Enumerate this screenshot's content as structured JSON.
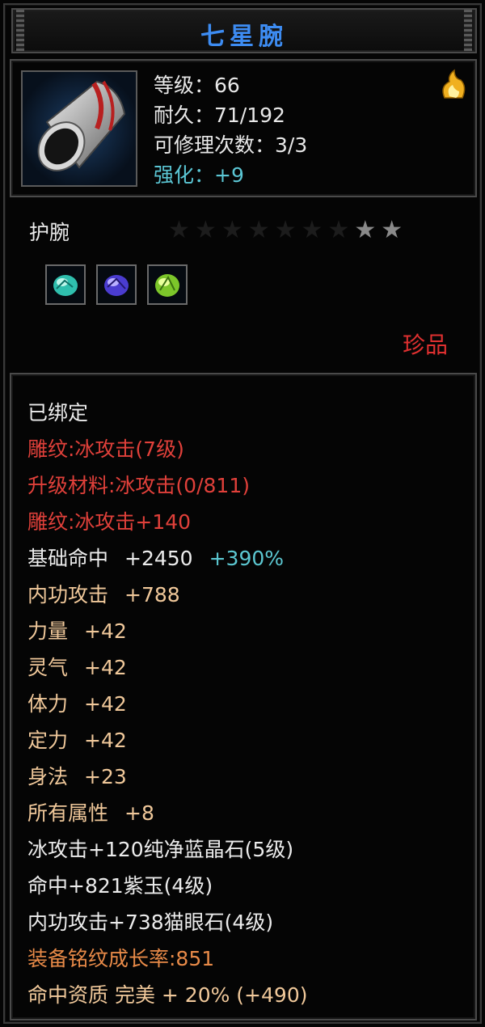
{
  "title": "七星腕",
  "header": {
    "level": "等级：66",
    "durability": "耐久：71/192",
    "repair": "可修理次数：3/3",
    "enhance": "强化：+9"
  },
  "item_type": "护腕",
  "stars": {
    "lit": 2,
    "total": 9
  },
  "rarity": "珍品",
  "gems": [
    "aqua-gem-icon",
    "purple-gem-icon",
    "green-gem-icon"
  ],
  "attributes": {
    "bound": "已绑定",
    "engrave_ice": "雕纹:冰攻击(7级)",
    "upgrade_material": "升级材料:冰攻击(0/811)",
    "engrave_ice_bonus": "雕纹:冰攻击+140",
    "hit_label": "基础命中",
    "hit_value": "+2450",
    "hit_percent": "+390%",
    "internal_attack_label": "内功攻击",
    "internal_attack_value": "+788",
    "strength_label": "力量",
    "strength_value": "+42",
    "spirit_label": "灵气",
    "spirit_value": "+42",
    "stamina_label": "体力",
    "stamina_value": "+42",
    "focus_label": "定力",
    "focus_value": "+42",
    "agility_label": "身法",
    "agility_value": "+23",
    "all_attr_label": "所有属性",
    "all_attr_value": "+8",
    "gem_line_1": "冰攻击+120纯净蓝晶石(5级)",
    "gem_line_2": "命中+821紫玉(4级)",
    "gem_line_3": "内功攻击+738猫眼石(4级)",
    "growth_rate": "装备铭纹成长率:851",
    "aptitude": "命中资质 完美 + 20% (+490)"
  },
  "colors": {
    "title": "#3d8cf2",
    "enhance": "#5bc6d4",
    "red": "#e0403a",
    "base_attr": "#f0c89a",
    "growth": "#e88a48"
  }
}
